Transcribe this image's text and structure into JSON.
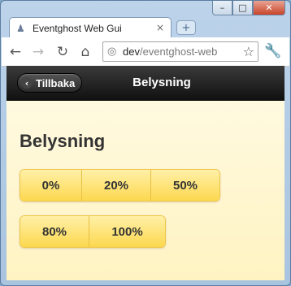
{
  "browser": {
    "tab_title": "Eventghost Web Gui",
    "tab_close_glyph": "×",
    "new_tab_glyph": "+",
    "address": {
      "host": "dev",
      "path": "/eventghost-web"
    },
    "window_controls": {
      "minimize": "–",
      "maximize": "□",
      "close": "✕"
    }
  },
  "header": {
    "back_label": "Tillbaka",
    "title": "Belysning"
  },
  "content": {
    "title": "Belysning",
    "levels_row1": [
      "0%",
      "20%",
      "50%"
    ],
    "levels_row2": [
      "80%",
      "100%"
    ]
  },
  "colors": {
    "header_bg": "#1e1e1e",
    "button_yellow": "#fcd84e",
    "page_bg": "#fff8d6"
  }
}
